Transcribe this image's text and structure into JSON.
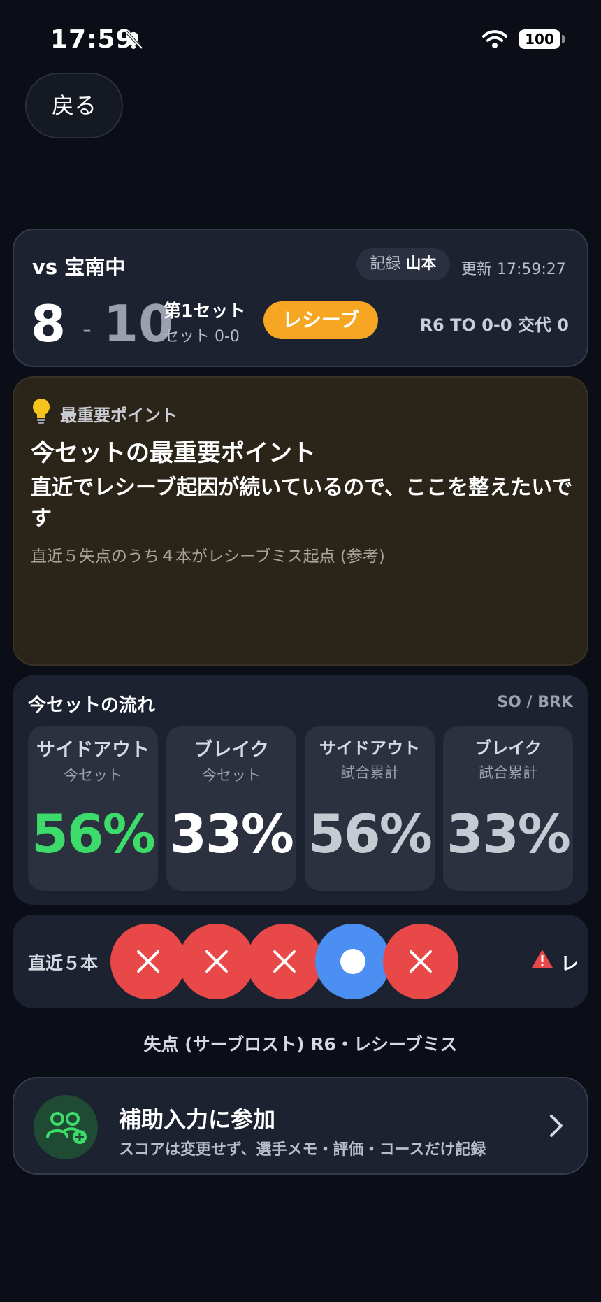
{
  "status_bar": {
    "time": "17:59",
    "battery": "100"
  },
  "nav": {
    "back_label": "戻る",
    "title": "宝南中"
  },
  "score_card": {
    "opponent": "vs 宝南中",
    "recorder_label": "記録",
    "recorder_name": "山本",
    "updated": "更新 17:59:27",
    "home_score": "8",
    "dash": "-",
    "away_score": "10",
    "set_label": "第1セット",
    "set_score": "セット 0-0",
    "phase": "レシーブ",
    "game_info": "R6  TO 0-0  交代 0",
    "phase_color": "#f6a623"
  },
  "insight": {
    "label": "最重要ポイント",
    "title": "今セットの最重要ポイント",
    "body": "直近でレシーブ起因が続いているので、ここを整えたいです",
    "note": "直近５失点のうち４本がレシーブミス起点 (参考)"
  },
  "flow": {
    "title": "今セットの流れ",
    "tag": "SO / BRK",
    "stats": [
      {
        "name": "サイドアウト",
        "scope": "今セット",
        "value": "56%"
      },
      {
        "name": "ブレイク",
        "scope": "今セット",
        "value": "33%"
      },
      {
        "name": "サイドアウト",
        "scope": "試合累計",
        "value": "56%"
      },
      {
        "name": "ブレイク",
        "scope": "試合累計",
        "value": "33%"
      }
    ]
  },
  "recent": {
    "label": "直近５本",
    "rallies": [
      "lost",
      "lost",
      "lost",
      "won",
      "lost"
    ],
    "warning_text": "レ"
  },
  "last_event": "失点 (サーブロスト) R6・レシーブミス",
  "assist": {
    "title": "補助入力に参加",
    "subtitle": "スコアは変更せず、選手メモ・評価・コースだけ記録"
  },
  "colors": {
    "lost": "#e84848",
    "won": "#4b8ff2",
    "accent_green": "#3ddc6a"
  }
}
